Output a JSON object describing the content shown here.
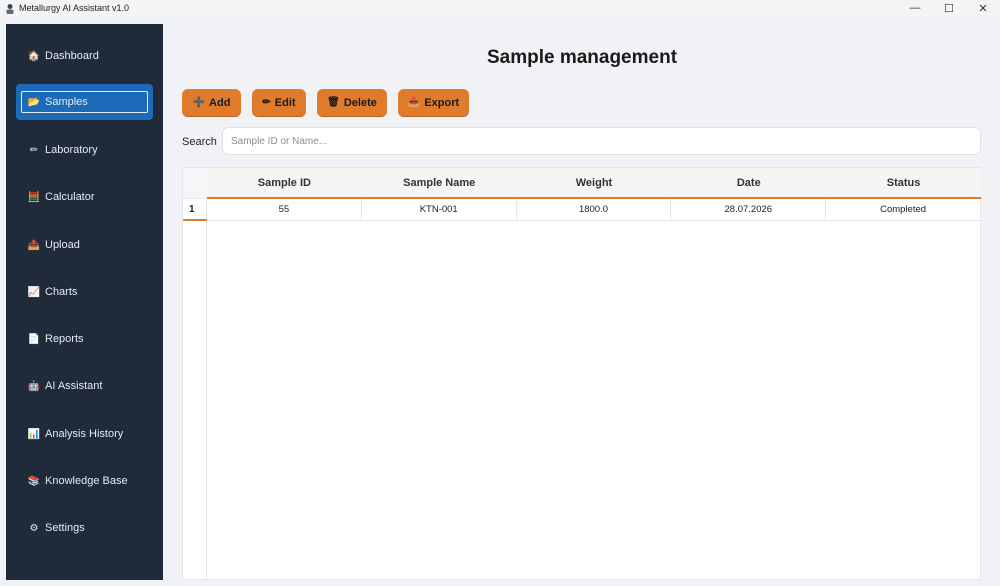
{
  "window": {
    "title": "Metallurgy AI Assistant v1.0",
    "minimize": "—",
    "maximize": "☐",
    "close": "✕"
  },
  "sidebar": {
    "items": [
      {
        "label": "Dashboard",
        "icon": "dashboard-icon",
        "glyph": "🏠"
      },
      {
        "label": "Samples",
        "icon": "folder-icon",
        "glyph": "📂"
      },
      {
        "label": "Laboratory",
        "icon": "pencil-icon",
        "glyph": "✏"
      },
      {
        "label": "Calculator",
        "icon": "calculator-icon",
        "glyph": "🧮"
      },
      {
        "label": "Upload",
        "icon": "upload-icon",
        "glyph": "📤"
      },
      {
        "label": "Charts",
        "icon": "line-chart-icon",
        "glyph": "📈"
      },
      {
        "label": "Reports",
        "icon": "document-icon",
        "glyph": "📄"
      },
      {
        "label": "AI Assistant",
        "icon": "robot-icon",
        "glyph": "🤖"
      },
      {
        "label": "Analysis History",
        "icon": "bar-chart-icon",
        "glyph": "📊"
      },
      {
        "label": "Knowledge Base",
        "icon": "books-icon",
        "glyph": "📚"
      },
      {
        "label": "Settings",
        "icon": "gear-icon",
        "glyph": "⚙"
      }
    ],
    "active_index": 1
  },
  "main": {
    "title": "Sample management",
    "toolbar": {
      "add": {
        "label": "Add",
        "glyph": "➕"
      },
      "edit": {
        "label": "Edit",
        "glyph": "✏"
      },
      "delete": {
        "label": "Delete",
        "glyph": "🗑"
      },
      "export": {
        "label": "Export",
        "glyph": "📤"
      }
    },
    "search": {
      "label": "Search",
      "placeholder": "Sample ID or Name...",
      "value": ""
    },
    "table": {
      "columns": [
        "Sample ID",
        "Sample Name",
        "Weight",
        "Date",
        "Status"
      ],
      "rows": [
        {
          "num": "1",
          "cells": [
            "55",
            "KTN-001",
            "1800.0",
            "28.07.2026",
            "Completed"
          ]
        }
      ]
    }
  },
  "colors": {
    "accent": "#e07b2c",
    "sidebar_bg": "#1f2a3b",
    "active_item": "#1c6ab8"
  }
}
